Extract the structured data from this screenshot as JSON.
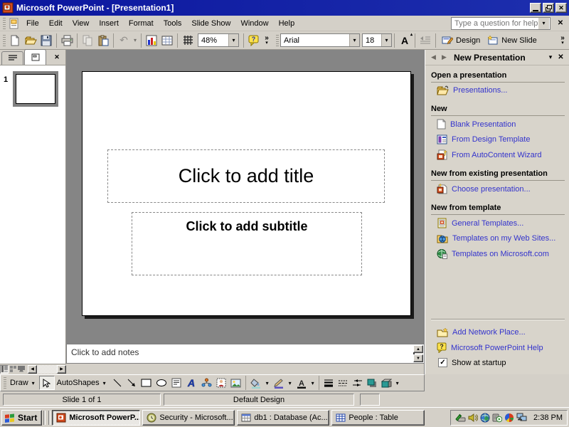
{
  "window": {
    "title": "Microsoft PowerPoint - [Presentation1]"
  },
  "menu_bar": {
    "items": [
      "File",
      "Edit",
      "View",
      "Insert",
      "Format",
      "Tools",
      "Slide Show",
      "Window",
      "Help"
    ],
    "ask_box_placeholder": "Type a question for help"
  },
  "standard_toolbar": {
    "zoom_value": "48%"
  },
  "formatting_toolbar": {
    "font_name": "Arial",
    "font_size": "18",
    "design_label": "Design",
    "new_slide_label": "New Slide"
  },
  "slides_pane": {
    "slide_number": "1"
  },
  "slide": {
    "title_placeholder": "Click to add title",
    "subtitle_placeholder": "Click to add subtitle"
  },
  "notes_pane": {
    "placeholder": "Click to add notes"
  },
  "task_pane": {
    "title": "New Presentation",
    "sections": [
      {
        "header": "Open a presentation",
        "items": [
          {
            "label": "Presentations...",
            "icon": "open-folder-icon"
          }
        ]
      },
      {
        "header": "New",
        "items": [
          {
            "label": "Blank Presentation",
            "icon": "blank-document-icon"
          },
          {
            "label": "From Design Template",
            "icon": "design-template-icon"
          },
          {
            "label": "From AutoContent Wizard",
            "icon": "autocontent-wizard-icon"
          }
        ]
      },
      {
        "header": "New from existing presentation",
        "items": [
          {
            "label": "Choose presentation...",
            "icon": "choose-presentation-icon"
          }
        ]
      },
      {
        "header": "New from template",
        "items": [
          {
            "label": "General Templates...",
            "icon": "general-templates-icon"
          },
          {
            "label": "Templates on my Web Sites...",
            "icon": "web-templates-icon"
          },
          {
            "label": "Templates on Microsoft.com",
            "icon": "microsoft-templates-icon"
          }
        ]
      }
    ],
    "footer_links": [
      {
        "label": "Add Network Place...",
        "icon": "add-network-place-icon"
      },
      {
        "label": "Microsoft PowerPoint Help",
        "icon": "help-bubble-icon"
      }
    ],
    "startup_checkbox": {
      "label": "Show at startup",
      "checked": true
    }
  },
  "drawing_toolbar": {
    "draw_label": "Draw",
    "autoshapes_label": "AutoShapes"
  },
  "status_bar": {
    "slide_indicator": "Slide 1 of 1",
    "design_name": "Default Design",
    "third_panel": ""
  },
  "taskbar": {
    "start_label": "Start",
    "buttons": [
      {
        "label": "Microsoft PowerP...",
        "active": true,
        "icon": "powerpoint-icon"
      },
      {
        "label": "Security - Microsoft...",
        "active": false,
        "icon": "security-clock-icon"
      },
      {
        "label": "db1 : Database (Ac...",
        "active": false,
        "icon": "access-database-icon"
      },
      {
        "label": "People : Table",
        "active": false,
        "icon": "table-icon"
      }
    ],
    "clock": "2:38 PM"
  },
  "glyphs": {
    "dropdown": "▾",
    "chevron_more": "»",
    "close": "✕",
    "back_arrow": "◀",
    "forward_arrow": "▶",
    "scroll_up": "▲",
    "scroll_down": "▼",
    "scroll_left": "◀",
    "scroll_right": "▶",
    "check": "✓",
    "undo": "↶",
    "help_q": "?",
    "letter_a": "A",
    "tri_up_small": "▴"
  },
  "colors": {
    "title_bar": "#0b169e",
    "button_face": "#d4d0c8",
    "slide_area_background": "#858585",
    "hyperlink_blue": "#3333cc",
    "title_text": "#ffffff"
  }
}
